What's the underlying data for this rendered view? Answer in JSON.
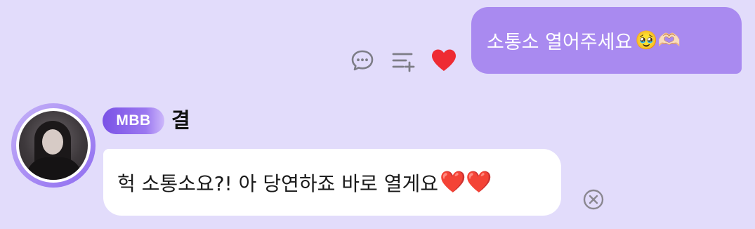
{
  "outgoing_message": {
    "text": "소통소 열어주세요",
    "emojis": "🥹🫶🏻",
    "bubble_color": "#a98af0"
  },
  "actions": {
    "items": [
      {
        "icon": "chat-bubble-icon"
      },
      {
        "icon": "add-to-list-icon"
      },
      {
        "icon": "heart-icon",
        "color": "#ee2b33"
      }
    ]
  },
  "incoming_message": {
    "sender": {
      "name": "결",
      "badge": "MBB",
      "avatar": "profile-photo"
    },
    "text": "헉 소통소요?! 아 당연하죠 바로 열게요",
    "emojis": "❤️❤️",
    "bubble_color": "#ffffff"
  },
  "close": {
    "icon": "close-circle-icon"
  },
  "theme": {
    "background": "#e2dcfb",
    "badge_gradient": [
      "#7a52e6",
      "#cdb8fb"
    ]
  }
}
